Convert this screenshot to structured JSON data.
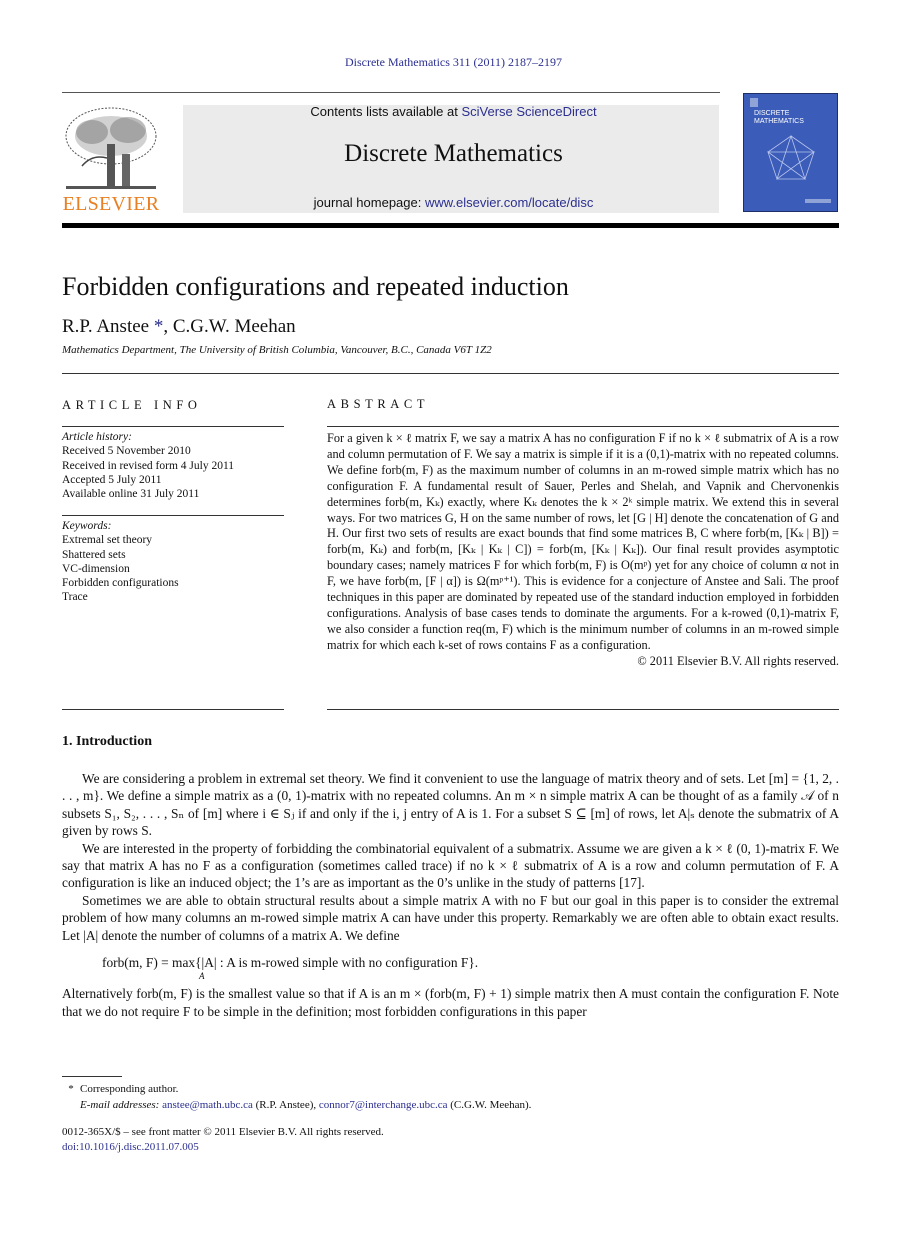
{
  "header": {
    "citation": "Discrete Mathematics 311 (2011) 2187–2197",
    "publisher_logo": "ELSEVIER",
    "contents_prefix": "Contents lists available at ",
    "contents_link": "SciVerse ScienceDirect",
    "journal_name": "Discrete Mathematics",
    "homepage_prefix": "journal homepage: ",
    "homepage_link": "www.elsevier.com/locate/disc",
    "cover_title_line1": "DISCRETE",
    "cover_title_line2": "MATHEMATICS",
    "colors": {
      "link": "#2b2f8f",
      "elsevier_orange": "#e87f22",
      "cover_blue": "#3b5cb8",
      "banner_gray": "#ebebeb"
    }
  },
  "article": {
    "title": "Forbidden configurations and repeated induction",
    "authors_part1": "R.P. Anstee ",
    "author_star": "*",
    "authors_part2": ", C.G.W. Meehan",
    "affiliation": "Mathematics Department, The University of British Columbia, Vancouver, B.C., Canada V6T 1Z2"
  },
  "article_info": {
    "heading": "ARTICLE INFO",
    "history_label": "Article history:",
    "history": [
      "Received 5 November 2010",
      "Received in revised form 4 July 2011",
      "Accepted 5 July 2011",
      "Available online 31 July 2011"
    ],
    "keywords_label": "Keywords:",
    "keywords": [
      "Extremal set theory",
      "Shattered sets",
      "VC-dimension",
      "Forbidden configurations",
      "Trace"
    ]
  },
  "abstract": {
    "heading": "ABSTRACT",
    "text": "For a given k × ℓ matrix F, we say a matrix A has no configuration F if no k × ℓ submatrix of A is a row and column permutation of F. We say a matrix is simple if it is a (0,1)-matrix with no repeated columns. We define forb(m, F) as the maximum number of columns in an m-rowed simple matrix which has no configuration F. A fundamental result of Sauer, Perles and Shelah, and Vapnik and Chervonenkis determines forb(m, Kₖ) exactly, where Kₖ denotes the k × 2ᵏ simple matrix. We extend this in several ways. For two matrices G, H on the same number of rows, let [G | H] denote the concatenation of G and H. Our first two sets of results are exact bounds that find some matrices B, C where forb(m, [Kₖ | B]) = forb(m, Kₖ) and forb(m, [Kₖ | Kₖ | C]) = forb(m, [Kₖ | Kₖ]). Our final result provides asymptotic boundary cases; namely matrices F for which forb(m, F) is O(mᵖ) yet for any choice of column α not in F, we have forb(m, [F | α]) is Ω(mᵖ⁺¹). This is evidence for a conjecture of Anstee and Sali. The proof techniques in this paper are dominated by repeated use of the standard induction employed in forbidden configurations. Analysis of base cases tends to dominate the arguments. For a k-rowed (0,1)-matrix F, we also consider a function req(m, F) which is the minimum number of columns in an m-rowed simple matrix for which each k-set of rows contains F as a configuration.",
    "copyright": "© 2011 Elsevier B.V. All rights reserved."
  },
  "introduction": {
    "heading": "1.  Introduction",
    "paragraphs": [
      "We are considering a problem in extremal set theory. We find it convenient to use the language of matrix theory and of sets. Let [m] = {1, 2, . . . , m}. We define a simple matrix as a (0, 1)-matrix with no repeated columns. An m × n simple matrix A can be thought of as a family 𝒜 of n subsets S₁, S₂, . . . , Sₙ of [m] where i ∈ Sⱼ if and only if the i, j entry of A is 1. For a subset S ⊆ [m] of rows, let A|ₛ denote the submatrix of A given by rows S.",
      "We are interested in the property of forbidding the combinatorial equivalent of a submatrix. Assume we are given a k × ℓ (0, 1)-matrix F. We say that matrix A has no F as a configuration (sometimes called trace) if no k × ℓ submatrix of A is a row and column permutation of F. A configuration is like an induced object; the 1’s are as important as the 0’s unlike in the study of patterns [17].",
      "Sometimes we are able to obtain structural results about a simple matrix A with no F but our goal in this paper is to consider the extremal problem of how many columns an m-rowed simple matrix A can have under this property. Remarkably we are often able to obtain exact results. Let |A| denote the number of columns of a matrix A. We define"
    ],
    "equation": "forb(m, F) = max{|A| : A is m-rowed simple with no configuration F}.",
    "equation_subscript": "A",
    "after_equation": "Alternatively forb(m, F) is the smallest value so that if A is an m × (forb(m, F) + 1) simple matrix then A must contain the configuration F. Note that we do not require F to be simple in the definition; most forbidden configurations in this paper"
  },
  "footnotes": {
    "star": "*",
    "corresponding": "Corresponding author.",
    "email_label": "E-mail addresses: ",
    "email1": "anstee@math.ubc.ca",
    "email1_name": " (R.P. Anstee), ",
    "email2": "connor7@interchange.ubc.ca",
    "email2_name": " (C.G.W. Meehan).",
    "front_matter": "0012-365X/$ – see front matter © 2011 Elsevier B.V. All rights reserved.",
    "doi": "doi:10.1016/j.disc.2011.07.005"
  }
}
